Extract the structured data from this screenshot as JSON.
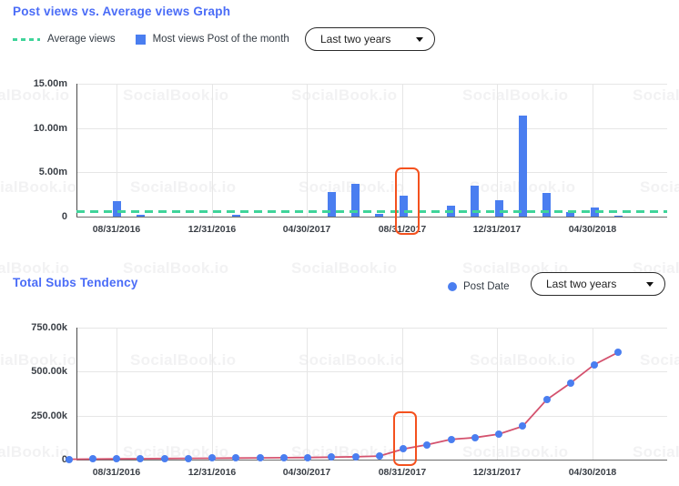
{
  "watermark": {
    "text": "SocialBook.io"
  },
  "panel_one": {
    "title": "Post views vs. Average views Graph",
    "legend": [
      {
        "name": "average-views",
        "label": "Average views",
        "marker": "dashed-line",
        "color": "#3fd49a"
      },
      {
        "name": "most-views-post",
        "label": "Most views Post of the month",
        "marker": "square",
        "color": "#4a7ef0"
      }
    ],
    "dropdown": {
      "label": "Last two years",
      "icon": "chevron-down-icon"
    }
  },
  "panel_two": {
    "title": "Total Subs Tendency",
    "legend": [
      {
        "name": "post-date",
        "label": "Post Date",
        "marker": "dot",
        "color": "#4a7ef0"
      }
    ],
    "dropdown": {
      "label": "Last two years",
      "icon": "chevron-down-icon"
    }
  },
  "chart_data": [
    {
      "type": "bar",
      "title": "Post views vs. Average views Graph",
      "xlabel": "",
      "ylabel": "",
      "ylim": [
        0,
        15000000
      ],
      "ytick_labels": [
        "0",
        "5.00m",
        "10.00m",
        "15.00m"
      ],
      "ytick_values": [
        0,
        5000000,
        10000000,
        15000000
      ],
      "xtick_labels": [
        "08/31/2016",
        "12/31/2016",
        "04/30/2017",
        "08/31/2017",
        "12/31/2017",
        "04/30/2018"
      ],
      "grid": true,
      "legend_position": "top-left",
      "series": [
        {
          "name": "Most views Post of the month",
          "color": "#4a7ef0",
          "values": [
            0,
            0,
            1700000,
            200000,
            0,
            0,
            0,
            170000,
            0,
            0,
            0,
            2800000,
            3750000,
            280000,
            2400000,
            0,
            1250000,
            3450000,
            1800000,
            11400000,
            2650000,
            500000,
            1000000,
            110000
          ]
        },
        {
          "name": "Average views",
          "color": "#3fd49a",
          "type": "constant-line",
          "value": 600000
        }
      ],
      "annotations": [
        {
          "name": "highlight-box",
          "color": "#f4511e",
          "around_x": "08/31/2017"
        }
      ]
    },
    {
      "type": "line",
      "title": "Total Subs Tendency",
      "xlabel": "",
      "ylabel": "",
      "ylim": [
        0,
        750000
      ],
      "ytick_labels": [
        "0",
        "250.00k",
        "500.00k",
        "750.00k"
      ],
      "ytick_values": [
        0,
        250000,
        500000,
        750000
      ],
      "xtick_labels": [
        "08/31/2016",
        "12/31/2016",
        "04/30/2017",
        "08/31/2017",
        "12/31/2017",
        "04/30/2018"
      ],
      "grid": true,
      "legend_position": "top-right",
      "series": [
        {
          "name": "Post Date",
          "color": "#d4526e",
          "marker_color": "#4a7ef0",
          "values": [
            2000,
            3000,
            4000,
            5000,
            6000,
            7000,
            8000,
            9000,
            10000,
            11000,
            12000,
            14000,
            16000,
            20000,
            60000,
            85000,
            115000,
            125000,
            145000,
            190000,
            340000,
            435000,
            540000,
            610000
          ]
        }
      ],
      "annotations": [
        {
          "name": "highlight-box",
          "color": "#f4511e",
          "around_x": "08/31/2017"
        }
      ]
    }
  ]
}
